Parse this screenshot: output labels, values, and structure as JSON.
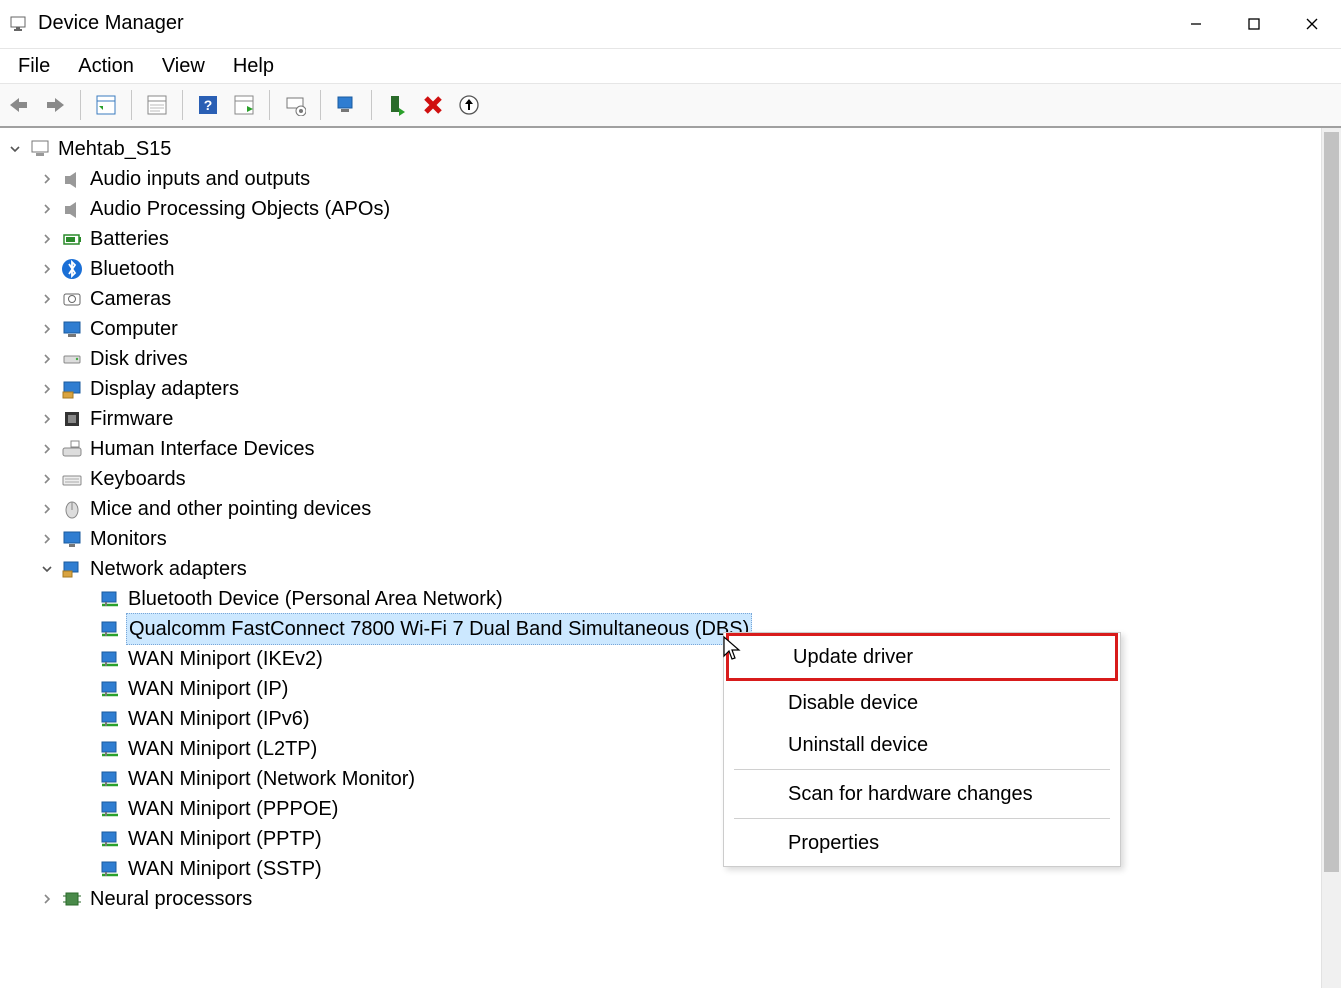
{
  "window": {
    "title": "Device Manager"
  },
  "menu": {
    "file": "File",
    "action": "Action",
    "view": "View",
    "help": "Help"
  },
  "tree": {
    "root": "Mehtab_S15",
    "categories": [
      {
        "label": "Audio inputs and outputs"
      },
      {
        "label": "Audio Processing Objects (APOs)"
      },
      {
        "label": "Batteries"
      },
      {
        "label": "Bluetooth"
      },
      {
        "label": "Cameras"
      },
      {
        "label": "Computer"
      },
      {
        "label": "Disk drives"
      },
      {
        "label": "Display adapters"
      },
      {
        "label": "Firmware"
      },
      {
        "label": "Human Interface Devices"
      },
      {
        "label": "Keyboards"
      },
      {
        "label": "Mice and other pointing devices"
      },
      {
        "label": "Monitors"
      },
      {
        "label": "Network adapters",
        "expanded": true
      },
      {
        "label": "Neural processors"
      }
    ],
    "network_devices": [
      "Bluetooth Device (Personal Area Network)",
      "Qualcomm FastConnect 7800 Wi-Fi 7 Dual Band Simultaneous (DBS)",
      "WAN Miniport (IKEv2)",
      "WAN Miniport (IP)",
      "WAN Miniport (IPv6)",
      "WAN Miniport (L2TP)",
      "WAN Miniport (Network Monitor)",
      "WAN Miniport (PPPOE)",
      "WAN Miniport (PPTP)",
      "WAN Miniport (SSTP)"
    ],
    "selected_device_index": 1
  },
  "context_menu": {
    "update": "Update driver",
    "disable": "Disable device",
    "uninstall": "Uninstall device",
    "scan": "Scan for hardware changes",
    "properties": "Properties"
  }
}
